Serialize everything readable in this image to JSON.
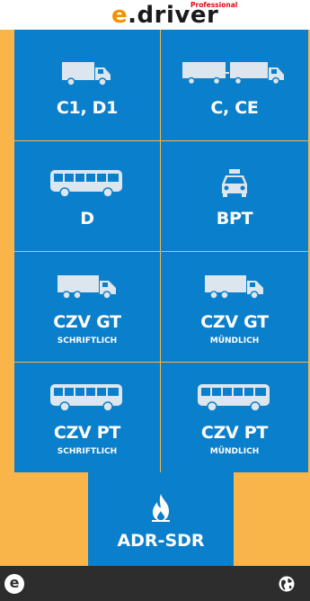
{
  "header": {
    "logo_prefix": "e",
    "logo_dot": ".",
    "logo_main": "driver",
    "logo_badge": "Professional"
  },
  "tiles": [
    {
      "label": "C1, D1",
      "sub": "",
      "icon": "truck-icon"
    },
    {
      "label": "C, CE",
      "sub": "",
      "icon": "truck-trailer-icon"
    },
    {
      "label": "D",
      "sub": "",
      "icon": "bus-icon"
    },
    {
      "label": "BPT",
      "sub": "",
      "icon": "taxi-icon"
    },
    {
      "label": "CZV GT",
      "sub": "SCHRIFTLICH",
      "icon": "truck-icon"
    },
    {
      "label": "CZV GT",
      "sub": "MÜNDLICH",
      "icon": "truck-icon"
    },
    {
      "label": "CZV PT",
      "sub": "SCHRIFTLICH",
      "icon": "bus-icon"
    },
    {
      "label": "CZV PT",
      "sub": "MÜNDLICH",
      "icon": "bus-icon"
    }
  ],
  "adr": {
    "label": "ADR-SDR",
    "icon": "flame-icon"
  },
  "bottom": {
    "e_button": "e",
    "globe_icon": "globe-icon"
  },
  "colors": {
    "tile": "#0A7FCB",
    "background": "#F9B54A",
    "bottombar": "#2D2D2D"
  }
}
